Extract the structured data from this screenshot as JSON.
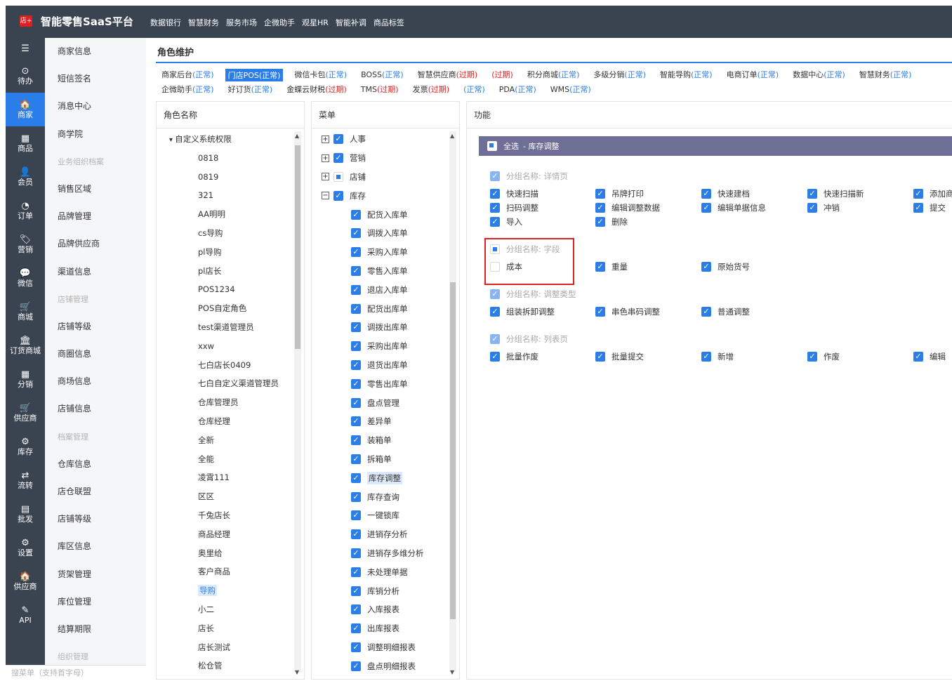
{
  "header": {
    "logo_text": "店+",
    "app_title": "智能零售SaaS平台",
    "nav": [
      "数据银行",
      "智慧财务",
      "服务市场",
      "企微助手",
      "观星HR",
      "智能补调",
      "商品标签"
    ]
  },
  "sidebar": {
    "items": [
      {
        "icon": "☰",
        "label": ""
      },
      {
        "icon": "⊙",
        "label": "待办"
      },
      {
        "icon": "🏠",
        "label": "商家"
      },
      {
        "icon": "▦",
        "label": "商品"
      },
      {
        "icon": "👤",
        "label": "会员"
      },
      {
        "icon": "◔",
        "label": "订单"
      },
      {
        "icon": "🏷",
        "label": "营销"
      },
      {
        "icon": "💬",
        "label": "微信"
      },
      {
        "icon": "🛒",
        "label": "商城"
      },
      {
        "icon": "🏛",
        "label": "订货商城"
      },
      {
        "icon": "▦",
        "label": "分销"
      },
      {
        "icon": "🛒",
        "label": "供应商"
      },
      {
        "icon": "⚙",
        "label": "库存"
      },
      {
        "icon": "⇄",
        "label": "流转"
      },
      {
        "icon": "▤",
        "label": "批发"
      },
      {
        "icon": "⚙",
        "label": "设置"
      },
      {
        "icon": "🏠",
        "label": "供应商"
      },
      {
        "icon": "✎",
        "label": "API"
      }
    ],
    "active_index": 2
  },
  "submenu": {
    "items": [
      {
        "label": "商家信息",
        "group": false
      },
      {
        "label": "短信签名",
        "group": false
      },
      {
        "label": "消息中心",
        "group": false
      },
      {
        "label": "商学院",
        "group": false
      },
      {
        "label": "业务组织档案",
        "group": true
      },
      {
        "label": "销售区域",
        "group": false
      },
      {
        "label": "品牌管理",
        "group": false
      },
      {
        "label": "品牌供应商",
        "group": false
      },
      {
        "label": "渠道信息",
        "group": false
      },
      {
        "label": "店铺管理",
        "group": true
      },
      {
        "label": "店铺等级",
        "group": false
      },
      {
        "label": "商圈信息",
        "group": false
      },
      {
        "label": "商场信息",
        "group": false
      },
      {
        "label": "店铺信息",
        "group": false
      },
      {
        "label": "档案管理",
        "group": true
      },
      {
        "label": "仓库信息",
        "group": false
      },
      {
        "label": "店仓联盟",
        "group": false
      },
      {
        "label": "店铺等级",
        "group": false
      },
      {
        "label": "库区信息",
        "group": false
      },
      {
        "label": "货架管理",
        "group": false
      },
      {
        "label": "库位管理",
        "group": false
      },
      {
        "label": "结算期限",
        "group": false
      },
      {
        "label": "组织管理",
        "group": true
      }
    ],
    "search_placeholder": "搜菜单（支持首字母）"
  },
  "page": {
    "title": "角色维护"
  },
  "tabs": {
    "row1": [
      {
        "name": "商家后台",
        "status": "(正常)",
        "expired": false
      },
      {
        "name": "门店POS",
        "status": "(正常)",
        "expired": false,
        "selected": true
      },
      {
        "name": "微信卡包",
        "status": "(正常)",
        "expired": false
      },
      {
        "name": "BOSS",
        "status": "(正常)",
        "expired": false
      },
      {
        "name": "智慧供应商",
        "status": "(过期)",
        "expired": true
      },
      {
        "name": "",
        "status": "(过期)",
        "expired": true
      },
      {
        "name": "积分商城",
        "status": "(正常)",
        "expired": false
      },
      {
        "name": "多级分销",
        "status": "(正常)",
        "expired": false
      },
      {
        "name": "智能导购",
        "status": "(正常)",
        "expired": false
      },
      {
        "name": "电商订单",
        "status": "(正常)",
        "expired": false
      },
      {
        "name": "数据中心",
        "status": "(正常)",
        "expired": false
      },
      {
        "name": "智慧财务",
        "status": "(正常)",
        "expired": false
      }
    ],
    "row2": [
      {
        "name": "企微助手",
        "status": "(正常)",
        "expired": false
      },
      {
        "name": "好订货",
        "status": "(正常)",
        "expired": false
      },
      {
        "name": "金蝶云财税",
        "status": "(过期)",
        "expired": true
      },
      {
        "name": "TMS",
        "status": "(过期)",
        "expired": true
      },
      {
        "name": "发票",
        "status": "(过期)",
        "expired": true
      },
      {
        "name": "",
        "status": "(正常)",
        "expired": false
      },
      {
        "name": "PDA",
        "status": "(正常)",
        "expired": false
      },
      {
        "name": "WMS",
        "status": "(正常)",
        "expired": false
      }
    ]
  },
  "roles_panel": {
    "header": "角色名称",
    "root": "自定义系统权限",
    "items": [
      "0818",
      "0819",
      "321",
      "AA明明",
      "cs导购",
      "pl导购",
      "pl店长",
      "POS1234",
      "POS自定角色",
      "test渠道管理员",
      "xxw",
      "七白店长0409",
      "七白自定义渠道管理员",
      "仓库管理员",
      "仓库经理",
      "全新",
      "全能",
      "凌霄111",
      "区区",
      "千兔店长",
      "商品经理",
      "奥里给",
      "客户商品",
      "导购",
      "小二",
      "店长",
      "店长测试",
      "松仓管"
    ],
    "highlight": "导购"
  },
  "menu_panel": {
    "header": "菜单",
    "top": [
      {
        "label": "人事",
        "state": "checked"
      },
      {
        "label": "营销",
        "state": "checked"
      },
      {
        "label": "店铺",
        "state": "partial"
      },
      {
        "label": "库存",
        "state": "checked",
        "expanded": true
      }
    ],
    "children": [
      "配货入库单",
      "调拨入库单",
      "采购入库单",
      "零售入库单",
      "退店入库单",
      "配货出库单",
      "调拨出库单",
      "采购出库单",
      "退货出库单",
      "零售出库单",
      "盘点管理",
      "差异单",
      "装箱单",
      "拆箱单",
      "库存调整",
      "库存查询",
      "一键锁库",
      "进销存分析",
      "进销存多维分析",
      "未处理单据",
      "库销分析",
      "入库报表",
      "出库报表",
      "调整明细报表",
      "盘点明细报表"
    ],
    "highlight": "库存调整"
  },
  "func_panel": {
    "header": "功能",
    "select_all": "全选",
    "section": "- 库存调整",
    "groups": [
      {
        "title": "分组名称: 详情页",
        "items": [
          "快速扫描",
          "吊牌打印",
          "快速建档",
          "快速扫描新",
          "添加商",
          "扫码调整",
          "编辑调整数据",
          "编辑单据信息",
          "冲销",
          "提交",
          "导入",
          "删除"
        ]
      },
      {
        "title": "分组名称: 字段",
        "items": [
          "成本",
          "重量",
          "原始货号"
        ]
      },
      {
        "title": "分组名称: 调整类型",
        "items": [
          "组装拆卸调整",
          "串色串码调整",
          "普通调整"
        ]
      },
      {
        "title": "分组名称: 列表页",
        "items": [
          "批量作废",
          "批量提交",
          "新增",
          "作废",
          "编辑"
        ]
      }
    ]
  }
}
